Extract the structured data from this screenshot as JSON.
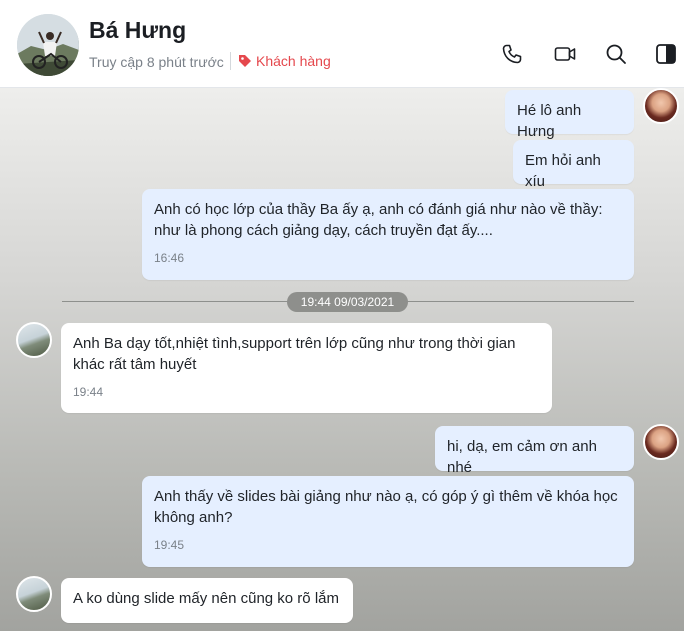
{
  "header": {
    "name": "Bá Hưng",
    "status": "Truy cập 8 phút trước",
    "tag": "Khách hàng",
    "icons": [
      "phone-icon",
      "video-icon",
      "search-icon",
      "sidebar-toggle-icon"
    ]
  },
  "messages": [
    {
      "side": "out",
      "text": "Hé lô anh Hưng"
    },
    {
      "side": "out",
      "text": "Em hỏi anh xíu"
    },
    {
      "side": "out",
      "text": "Anh có học lớp của thầy Ba ấy ạ, anh có đánh giá như nào về thầy: như là phong cách giảng dạy, cách truyền đạt ấy....",
      "time": "16:46"
    },
    {
      "side": "in",
      "text": "Anh Ba dạy tốt,nhiệt tình,support trên lớp cũng như trong thời gian khác rất tâm huyết",
      "time": "19:44"
    },
    {
      "side": "out",
      "text": "hi, dạ, em cảm ơn anh nhé"
    },
    {
      "side": "out",
      "text": "Anh thấy về slides bài giảng như nào ạ, có góp ý gì thêm về khóa học không anh?",
      "time": "19:45"
    },
    {
      "side": "in",
      "text": "A ko dùng slide mấy nên cũng ko rõ lắm"
    }
  ],
  "divider": "19:44 09/03/2021",
  "colors": {
    "tag": "#e5484d",
    "outgoing_bubble": "#e5efff",
    "incoming_bubble": "#ffffff"
  }
}
